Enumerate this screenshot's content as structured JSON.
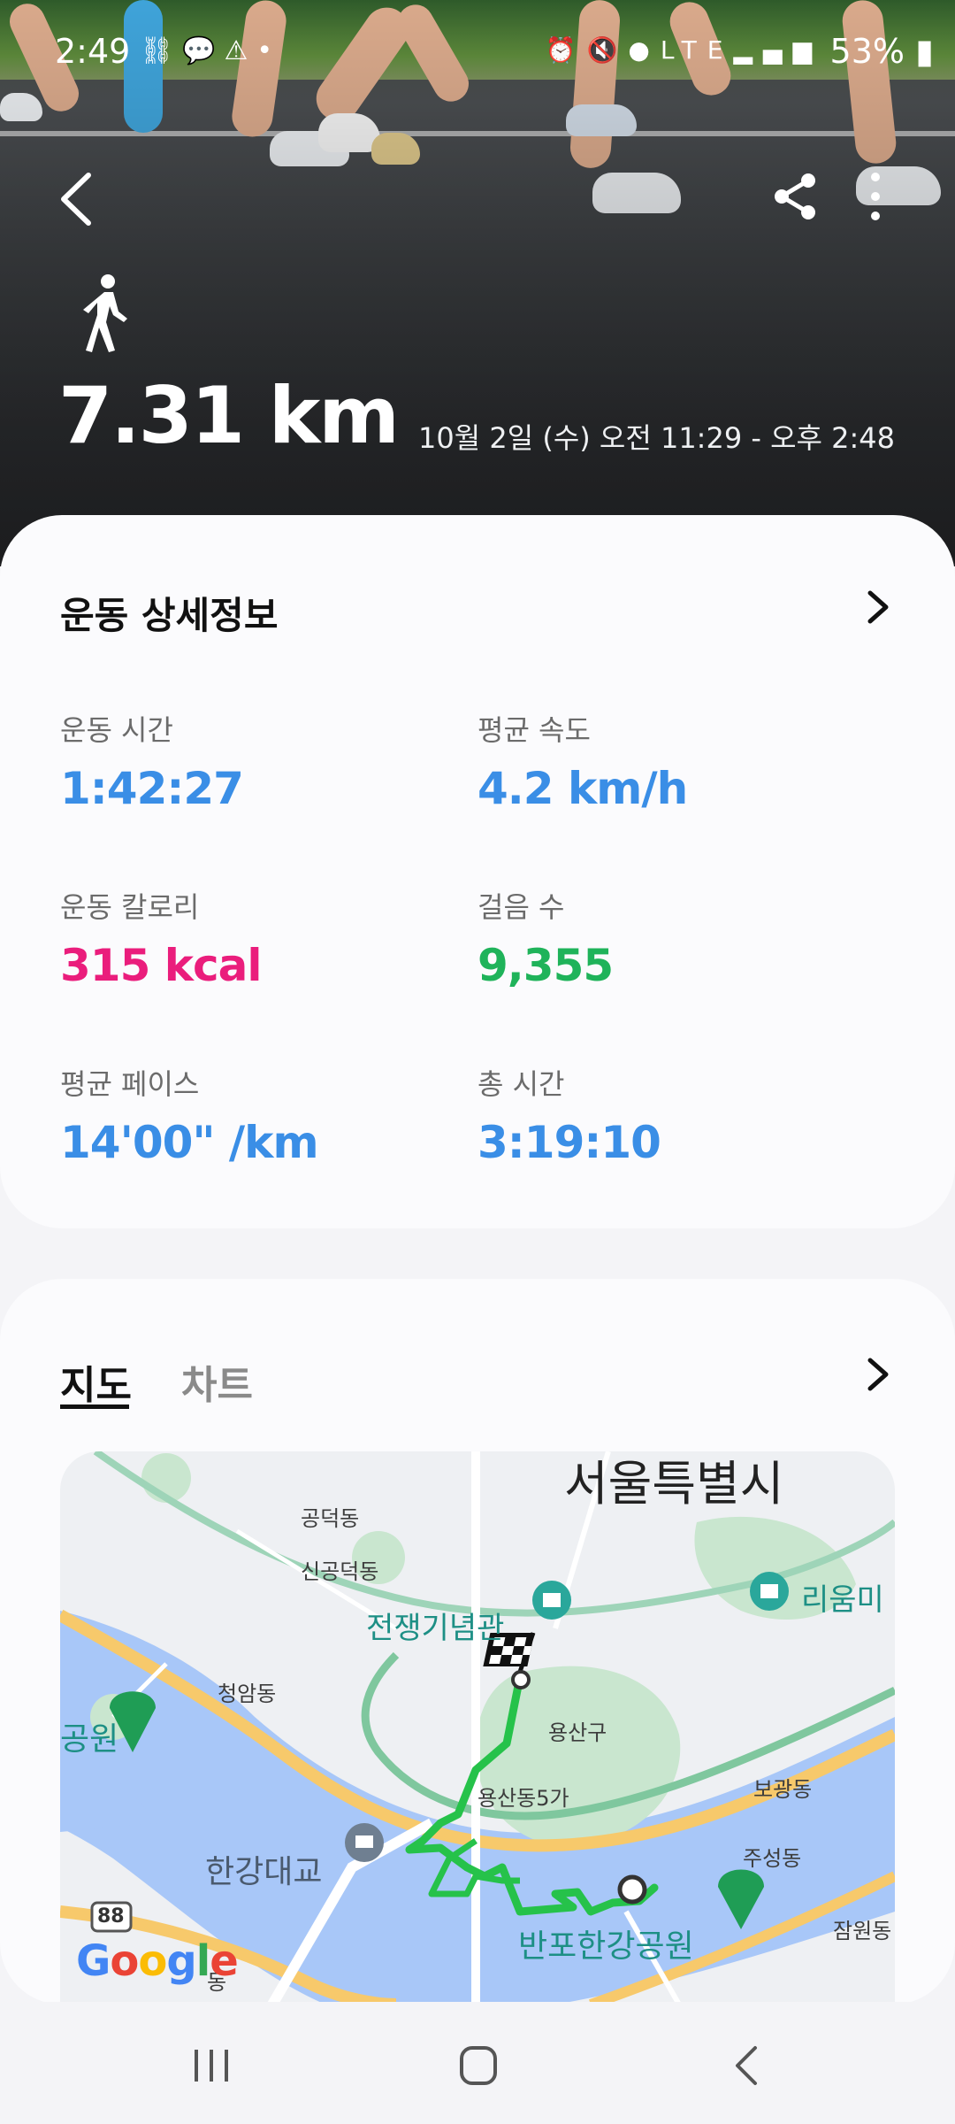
{
  "status_bar": {
    "time": "2:49",
    "battery": "53%",
    "left_icons": [
      "link-icon",
      "talk-icon",
      "warning-icon",
      "dot-icon"
    ],
    "right_icons": [
      "alarm-icon",
      "mute-icon",
      "location-icon",
      "lte-icon",
      "signal-icon"
    ]
  },
  "header": {
    "distance": "7.31 km",
    "datetime": "10월 2일 (수) 오전 11:29 - 오후 2:48",
    "activity_icon": "walking-icon"
  },
  "details": {
    "title": "운동 상세정보",
    "stats": [
      {
        "label": "운동 시간",
        "value": "1:42:27",
        "color": "#3a8ee6"
      },
      {
        "label": "평균 속도",
        "value": "4.2 km/h",
        "color": "#3a8ee6"
      },
      {
        "label": "운동 칼로리",
        "value": "315 kcal",
        "color": "#ea1d7c"
      },
      {
        "label": "걸음 수",
        "value": "9,355",
        "color": "#1fb35a"
      },
      {
        "label": "평균 페이스",
        "value": "14'00\" /km",
        "color": "#3a8ee6"
      },
      {
        "label": "총 시간",
        "value": "3:19:10",
        "color": "#3a8ee6"
      }
    ]
  },
  "map_section": {
    "tabs": [
      "지도",
      "차트"
    ],
    "selected_tab": "지도",
    "labels": {
      "seoul": "서울특별시",
      "gongdeok": "공덕동",
      "sinseol": "신공덕동",
      "war_memorial": "전쟁기념관",
      "leeum": "리움미",
      "cheongam": "청암동",
      "yongsan_gu": "용산구",
      "yongsan5ga": "용산동5가",
      "bogwang": "보광동",
      "hangang_bridge": "한강대교",
      "jusung": "주성동",
      "banpo": "반포한강공원",
      "jamwon": "잠원동",
      "park_left": "공원",
      "route_88": "88",
      "google": "Google",
      "dong": "동"
    }
  },
  "colors": {
    "accent_blue": "#3a8ee6",
    "calorie_pink": "#ea1d7c",
    "steps_green": "#1fb35a",
    "route_green": "#26c24a"
  }
}
